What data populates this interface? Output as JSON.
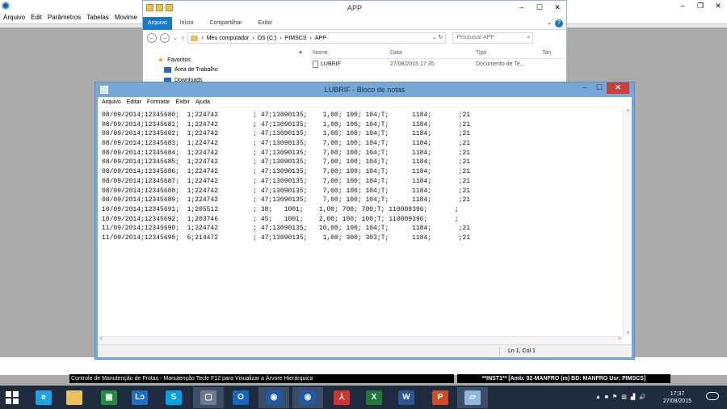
{
  "background_app": {
    "menu": [
      "Arquivo",
      "Edit",
      "Parâmetros",
      "Tabelas",
      "Movime"
    ],
    "window_controls": [
      "–",
      "❐",
      "✕"
    ],
    "status_left": "Controle de Manutenção de Frotas - Manutenção      Tecle F12 para Visualizar a Árvore Hierárquica",
    "status_right": "**INST1**   [Amb: 02-MANFRO  (m) BD: MANFRO Usr: PIMSCS]"
  },
  "explorer": {
    "title": "APP",
    "window_controls": [
      "–",
      "☐",
      "✕"
    ],
    "ribbon_tabs": [
      "Arquivo",
      "Início",
      "Compartilhar",
      "Exibir"
    ],
    "help": "?",
    "chevron": "⌄",
    "nav_buttons": [
      "←",
      "→",
      "⌄",
      "↑"
    ],
    "breadcrumb": [
      "Meu computador",
      "OS (C:)",
      "PIMSCS",
      "APP"
    ],
    "breadcrumb_sep": "›",
    "address_tail": "⌄  ↻",
    "search_placeholder": "Pesquisar APP",
    "search_icon": "⌕",
    "nav_pane": {
      "favorites": "Favoritos",
      "desktop": "Área de Trabalho",
      "downloads": "Downloads"
    },
    "scroll_up": "▲",
    "columns": [
      "Nome",
      "Data",
      "Tipo",
      "Tan"
    ],
    "files": [
      {
        "name": "LUBRIF",
        "date": "27/08/2015 17:35",
        "type": "Documento de Te..."
      }
    ]
  },
  "notepad": {
    "title": "LUBRIF - Bloco de notas",
    "window_controls": [
      "–",
      "☐",
      "✕"
    ],
    "menu": [
      "Arquivo",
      "Editar",
      "Formatar",
      "Exibir",
      "Ajuda"
    ],
    "lines": [
      "08/09/2014;12345680;  1;224742         ; 47;13090135;    1,00; 100; 104;T;      1184;       ;21",
      "08/09/2014;12345681;  1;224742         ; 47;13090135;    1,00; 100; 104;T;      1184;       ;21",
      "08/09/2014;12345682;  1;224742         ; 47;13090135;    1,00; 100; 104;T;      1184;       ;21",
      "08/09/2014;12345683;  1;224742         ; 47;13090135;    7,00; 100; 104;T;      1184;       ;21",
      "08/09/2014;12345684;  1;224742         ; 47;13090135;    7,00; 100; 104;T;      1184;       ;21",
      "08/09/2014;12345685;  1;224742         ; 47;13090135;    7,00; 100; 104;T;      1184;       ;21",
      "08/09/2014;12345686;  1;224742         ; 47;13090135;    7,00; 100; 104;T;      1184;       ;21",
      "08/09/2014;12345687;  1;224742         ; 47;13090135;    7,00; 100; 104;T;      1184;       ;21",
      "08/09/2014;12345688;  1;224742         ; 47;13090135;    7,00; 100; 104;T;      1184;       ;21",
      "08/09/2014;12345689;  1;224742         ; 47;13090135;    7,00; 100; 104;T;      1184;       ;21",
      "10/09/2014;12345691;  1;205512         ; 38;   1001;    1,00; 700; 700;T; 110009396;       ;",
      "10/09/2014;12345692;  1;203746         ; 45;   1001;    2,00; 100; 100;T; 110009396;       ;",
      "11/09/2014;12345690;  1;224742         ; 47;13090135;   10,00; 100; 104;T;      1184;       ;21",
      "11/09/2014;12345690;  6;214472         ; 47;13090135;    1,00; 300; 303;T;      1184;       ;21"
    ],
    "scroll_arrows": {
      "up": "˄",
      "down": "˅",
      "left": "<",
      "right": ">"
    },
    "cursor_position": "Ln 1, Col 1"
  },
  "taskbar": {
    "apps": [
      {
        "label": "e",
        "color": "#1ea1e6"
      },
      {
        "label": "",
        "color": "#e8c15a"
      },
      {
        "label": "▣",
        "color": "#1f8f3a"
      },
      {
        "label": "Lɔ",
        "color": "#1d6fc6"
      },
      {
        "label": "S",
        "color": "#00a2ed"
      },
      {
        "label": "▢",
        "color": "#6c7a8c"
      },
      {
        "label": "O",
        "color": "#1565c0"
      },
      {
        "label": "◉",
        "color": "#1d5aa8"
      },
      {
        "label": "◉",
        "color": "#1d5aa8"
      },
      {
        "label": "⅄",
        "color": "#d0342c"
      },
      {
        "label": "X",
        "color": "#1f7a3a"
      },
      {
        "label": "W",
        "color": "#2b5797"
      },
      {
        "label": "P",
        "color": "#d04a26"
      },
      {
        "label": "▱",
        "color": "#8fb7e0"
      }
    ],
    "tray": [
      "▲",
      "■",
      "⚑",
      "▥",
      "▟",
      "🔊"
    ],
    "time": "17:37",
    "date": "27/08/2015"
  }
}
